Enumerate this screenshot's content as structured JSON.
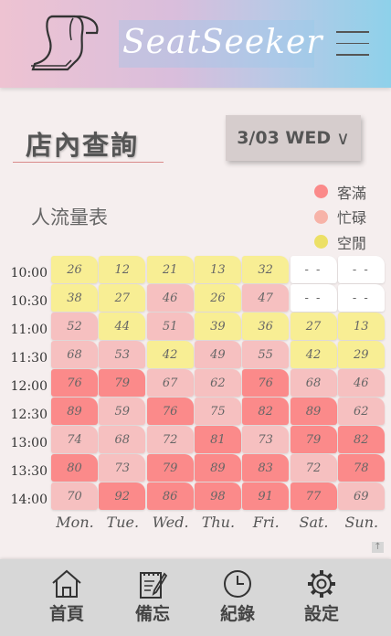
{
  "header": {
    "brand": "SeatSeeker"
  },
  "page_title": "店內查詢",
  "date_selector": {
    "label": "3/03 WED",
    "chevron": "∨"
  },
  "subtitle": "人流量表",
  "legend": [
    {
      "label": "客滿",
      "color": "#fb8a8a"
    },
    {
      "label": "忙碌",
      "color": "#f7b3a8"
    },
    {
      "label": "空閒",
      "color": "#ece066"
    }
  ],
  "times": [
    "10:00",
    "10:30",
    "11:00",
    "11:30",
    "12:00",
    "12:30",
    "13:00",
    "13:30",
    "14:00"
  ],
  "days": [
    "Mon.",
    "Tue.",
    "Wed.",
    "Thu.",
    "Fri.",
    "Sat.",
    "Sun."
  ],
  "table": [
    [
      "26",
      "12",
      "21",
      "13",
      "32",
      "- -",
      "- -"
    ],
    [
      "38",
      "27",
      "46",
      "26",
      "47",
      "- -",
      "- -"
    ],
    [
      "52",
      "44",
      "51",
      "39",
      "36",
      "27",
      "13"
    ],
    [
      "68",
      "53",
      "42",
      "49",
      "55",
      "42",
      "29"
    ],
    [
      "76",
      "79",
      "67",
      "62",
      "76",
      "68",
      "46"
    ],
    [
      "89",
      "59",
      "76",
      "75",
      "82",
      "89",
      "62"
    ],
    [
      "74",
      "68",
      "72",
      "81",
      "73",
      "79",
      "82"
    ],
    [
      "80",
      "73",
      "79",
      "89",
      "83",
      "72",
      "78"
    ],
    [
      "70",
      "92",
      "86",
      "98",
      "91",
      "77",
      "69"
    ]
  ],
  "status": [
    [
      "free",
      "free",
      "free",
      "free",
      "free",
      "none",
      "none"
    ],
    [
      "free",
      "free",
      "busy",
      "free",
      "busy",
      "none",
      "none"
    ],
    [
      "busy",
      "free",
      "busy",
      "free",
      "free",
      "free",
      "free"
    ],
    [
      "busy",
      "busy",
      "free",
      "busy",
      "busy",
      "free",
      "free"
    ],
    [
      "full",
      "full",
      "busy",
      "busy",
      "full",
      "busy",
      "busy"
    ],
    [
      "full",
      "busy",
      "full",
      "busy",
      "full",
      "full",
      "busy"
    ],
    [
      "busy",
      "busy",
      "busy",
      "full",
      "busy",
      "full",
      "full"
    ],
    [
      "full",
      "busy",
      "full",
      "full",
      "full",
      "busy",
      "full"
    ],
    [
      "busy",
      "full",
      "full",
      "full",
      "full",
      "full",
      "busy"
    ]
  ],
  "scroll_top_glyph": "↑",
  "nav": [
    {
      "label": "首頁",
      "icon": "home-icon"
    },
    {
      "label": "備忘",
      "icon": "memo-icon"
    },
    {
      "label": "紀錄",
      "icon": "clock-icon"
    },
    {
      "label": "設定",
      "icon": "gear-icon"
    }
  ]
}
